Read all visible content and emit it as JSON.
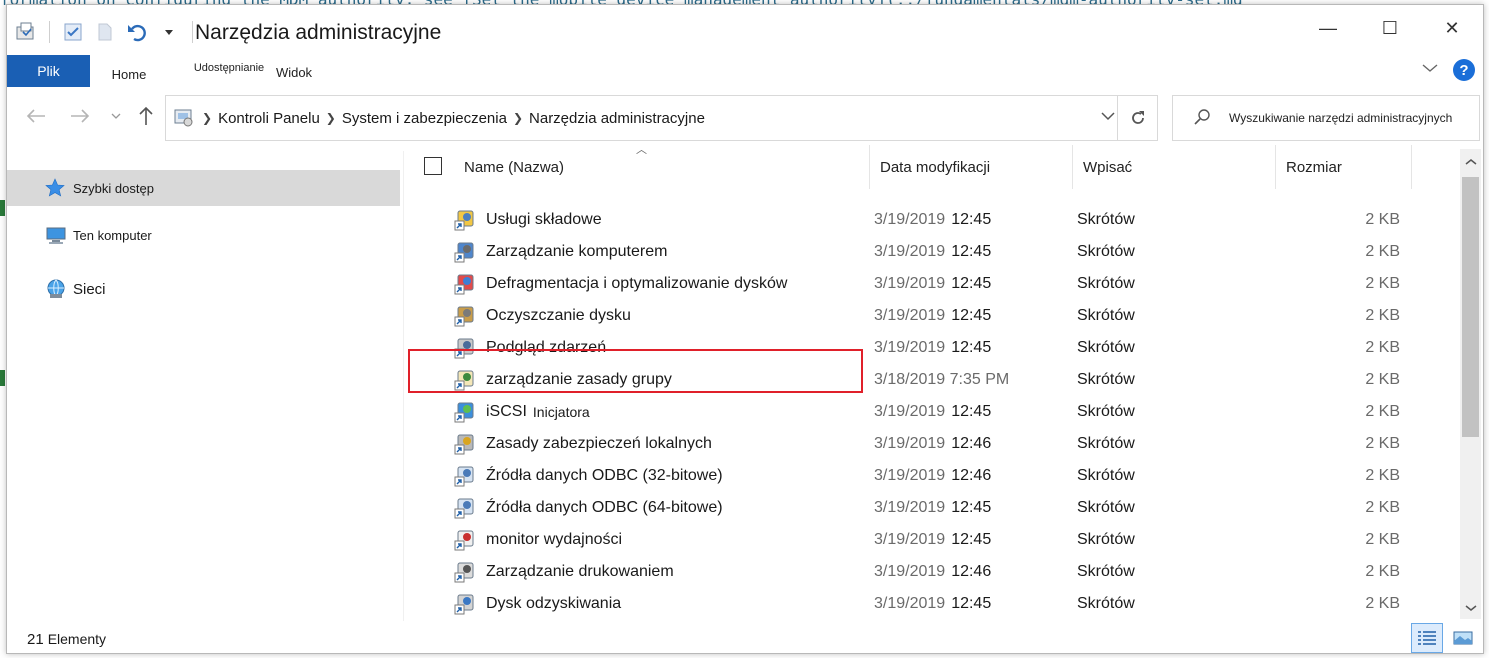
{
  "window": {
    "title": "Narzędzia administracyjne",
    "minimize": "—",
    "maximize": "☐",
    "close": "✕"
  },
  "background_code": {
    "top_line": "formation on configuring the MDM authority, see [Set the mobile device management authority](../fundamentals/mdm-authority-set.md"
  },
  "ribbon": {
    "file": "Plik",
    "home": "Home",
    "share": "Udostępnianie",
    "view": "Widok",
    "help": "?"
  },
  "address": {
    "crumbs": [
      "Kontroli Panelu",
      "System i zabezpieczenia",
      "Narzędzia administracyjne"
    ],
    "search_placeholder": "Wyszukiwanie narzędzi administracyjnych"
  },
  "nav": {
    "items": [
      {
        "label": "Szybki dostęp",
        "icon": "star-icon"
      },
      {
        "label": "Ten komputer",
        "icon": "computer-icon"
      },
      {
        "label": "Sieci",
        "icon": "network-icon"
      }
    ]
  },
  "columns": {
    "name": "Name (Nazwa)",
    "date": "Data modyfikacji",
    "type": "Wpisać",
    "size": "Rozmiar"
  },
  "files": [
    {
      "name": "Usługi składowe",
      "date": "3/19/2019",
      "time": "12:45",
      "type": "Skrótów",
      "size": "2 KB",
      "icon": "component-services-icon"
    },
    {
      "name": "Zarządzanie komputerem",
      "date": "3/19/2019",
      "time": "12:45",
      "type": "Skrótów",
      "size": "2 KB",
      "icon": "computer-management-icon"
    },
    {
      "name": "Defragmentacja i optymalizowanie dysków",
      "date": "3/19/2019",
      "time": "12:45",
      "type": "Skrótów",
      "size": "2 KB",
      "icon": "defrag-icon"
    },
    {
      "name": "Oczyszczanie dysku",
      "date": "3/19/2019",
      "time": "12:45",
      "type": "Skrótów",
      "size": "2 KB",
      "icon": "disk-cleanup-icon"
    },
    {
      "name": "Podgląd zdarzeń",
      "date": "3/19/2019",
      "time": "12:45",
      "type": "Skrótów",
      "size": "2 KB",
      "icon": "event-viewer-icon"
    },
    {
      "name": "zarządzanie zasady grupy",
      "date": "3/18/2019 7:35 PM",
      "time": "",
      "type": "Skrótów",
      "size": "2 KB",
      "icon": "group-policy-icon"
    },
    {
      "name": "iSCSI",
      "name_suffix": "Inicjatora",
      "date": "3/19/2019",
      "time": "12:45",
      "type": "Skrótów",
      "size": "2 KB",
      "icon": "iscsi-icon"
    },
    {
      "name": "Zasady zabezpieczeń lokalnych",
      "date": "3/19/2019",
      "time": "12:46",
      "type": "Skrótów",
      "size": "2 KB",
      "icon": "local-security-policy-icon"
    },
    {
      "name": "Źródła danych ODBC (32-bitowe)",
      "date": "3/19/2019",
      "time": "12:46",
      "type": "Skrótów",
      "size": "2 KB",
      "icon": "odbc-icon"
    },
    {
      "name": "Źródła danych ODBC (64-bitowe)",
      "date": "3/19/2019",
      "time": "12:45",
      "type": "Skrótów",
      "size": "2 KB",
      "icon": "odbc-icon"
    },
    {
      "name": "monitor wydajności",
      "date": "3/19/2019",
      "time": "12:45",
      "type": "Skrótów",
      "size": "2 KB",
      "icon": "performance-monitor-icon"
    },
    {
      "name": "Zarządzanie drukowaniem",
      "date": "3/19/2019",
      "time": "12:46",
      "type": "Skrótów",
      "size": "2 KB",
      "icon": "print-management-icon"
    },
    {
      "name": "Dysk odzyskiwania",
      "date": "3/19/2019",
      "time": "12:45",
      "type": "Skrótów",
      "size": "2 KB",
      "icon": "recovery-drive-icon"
    }
  ],
  "status": {
    "count": "21",
    "count_label": "Elementy"
  },
  "colors": {
    "file_tab": "#1a5fb4",
    "highlight": "#e0202a",
    "selection": "#d9d9d9"
  }
}
